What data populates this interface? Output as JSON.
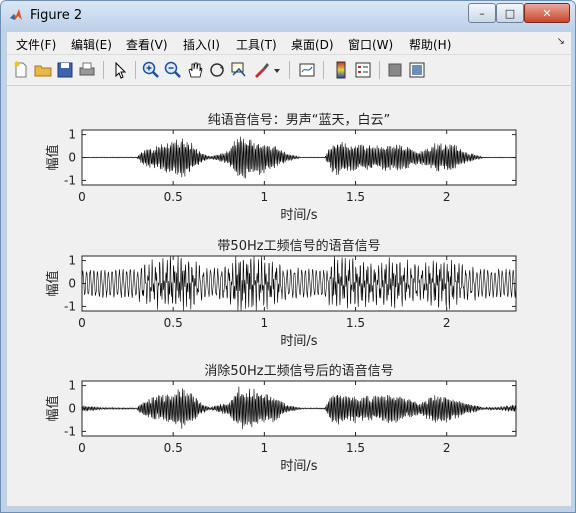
{
  "window": {
    "title": "Figure 2",
    "controls": {
      "minimize": "–",
      "maximize": "□",
      "close": "✕"
    }
  },
  "menu": {
    "items": [
      "文件(F)",
      "编辑(E)",
      "查看(V)",
      "插入(I)",
      "工具(T)",
      "桌面(D)",
      "窗口(W)",
      "帮助(H)"
    ],
    "overflow": "↘"
  },
  "toolbar": {
    "icons": [
      "new-figure-icon",
      "open-file-icon",
      "save-icon",
      "print-icon",
      "select-arrow-icon",
      "zoom-in-icon",
      "zoom-out-icon",
      "pan-hand-icon",
      "rotate-3d-icon",
      "data-cursor-icon",
      "brush-icon",
      "brush-menu-arrow-icon",
      "link-plot-icon",
      "insert-colorbar-icon",
      "insert-legend-icon",
      "hide-plot-tools-icon",
      "show-plot-tools-icon"
    ]
  },
  "chart_data": [
    {
      "type": "line",
      "title": "纯语音信号：男声“蓝天，白云”",
      "xlabel": "时间/s",
      "ylabel": "幅值",
      "xlim": [
        0,
        2.38
      ],
      "ylim": [
        -1.2,
        1.2
      ],
      "xticks": [
        "0",
        "0.5",
        "1",
        "1.5",
        "2"
      ],
      "yticks": [
        "1",
        "0",
        "-1"
      ],
      "series": [
        {
          "signal": "speech",
          "envelope_t": [
            0,
            0.3,
            0.33,
            0.42,
            0.5,
            0.55,
            0.6,
            0.65,
            0.7,
            0.8,
            0.85,
            0.9,
            0.95,
            1.05,
            1.12,
            1.2,
            1.33,
            1.38,
            1.45,
            1.55,
            1.6,
            1.7,
            1.75,
            1.85,
            1.95,
            2.05,
            2.1,
            2.2,
            2.38
          ],
          "envelope_a": [
            0.02,
            0.02,
            0.35,
            0.6,
            0.8,
            0.95,
            0.7,
            0.3,
            0.05,
            0.3,
            1.0,
            0.95,
            0.85,
            0.6,
            0.2,
            0.02,
            0.02,
            0.8,
            0.7,
            0.6,
            0.55,
            0.7,
            0.6,
            0.3,
            0.7,
            0.55,
            0.3,
            0.02,
            0.02
          ],
          "hum_amplitude": 0.0
        }
      ]
    },
    {
      "type": "line",
      "title": "带50Hz工频信号的语音信号",
      "xlabel": "时间/s",
      "ylabel": "幅值",
      "xlim": [
        0,
        2.38
      ],
      "ylim": [
        -1.2,
        1.2
      ],
      "xticks": [
        "0",
        "0.5",
        "1",
        "1.5",
        "2"
      ],
      "yticks": [
        "1",
        "0",
        "-1"
      ],
      "series": [
        {
          "signal": "speech + 50Hz hum",
          "envelope_t": [
            0,
            0.3,
            0.33,
            0.42,
            0.5,
            0.55,
            0.6,
            0.65,
            0.7,
            0.8,
            0.85,
            0.9,
            0.95,
            1.05,
            1.12,
            1.2,
            1.33,
            1.38,
            1.45,
            1.55,
            1.6,
            1.7,
            1.75,
            1.85,
            1.95,
            2.05,
            2.1,
            2.2,
            2.38
          ],
          "envelope_a": [
            0.02,
            0.02,
            0.35,
            0.6,
            0.8,
            0.95,
            0.7,
            0.3,
            0.05,
            0.3,
            1.0,
            0.95,
            0.85,
            0.6,
            0.2,
            0.02,
            0.02,
            0.8,
            0.7,
            0.6,
            0.55,
            0.7,
            0.6,
            0.3,
            0.7,
            0.55,
            0.3,
            0.02,
            0.02
          ],
          "hum_amplitude": 0.55
        }
      ]
    },
    {
      "type": "line",
      "title": "消除50Hz工频信号后的语音信号",
      "xlabel": "时间/s",
      "ylabel": "幅值",
      "xlim": [
        0,
        2.38
      ],
      "ylim": [
        -1.2,
        1.2
      ],
      "xticks": [
        "0",
        "0.5",
        "1",
        "1.5",
        "2"
      ],
      "yticks": [
        "1",
        "0",
        "-1"
      ],
      "series": [
        {
          "signal": "filtered speech",
          "envelope_t": [
            0,
            0.1,
            0.3,
            0.33,
            0.42,
            0.5,
            0.55,
            0.6,
            0.65,
            0.7,
            0.8,
            0.85,
            0.9,
            0.95,
            1.05,
            1.12,
            1.2,
            1.33,
            1.38,
            1.45,
            1.55,
            1.6,
            1.7,
            1.75,
            1.85,
            1.95,
            2.05,
            2.1,
            2.2,
            2.3,
            2.38
          ],
          "envelope_a": [
            0.15,
            0.05,
            0.03,
            0.35,
            0.6,
            0.8,
            0.95,
            0.7,
            0.3,
            0.05,
            0.3,
            1.0,
            0.95,
            0.85,
            0.6,
            0.2,
            0.03,
            0.03,
            0.8,
            0.7,
            0.6,
            0.55,
            0.7,
            0.6,
            0.3,
            0.7,
            0.55,
            0.3,
            0.05,
            0.08,
            0.2
          ],
          "hum_amplitude": 0.0
        }
      ]
    }
  ]
}
